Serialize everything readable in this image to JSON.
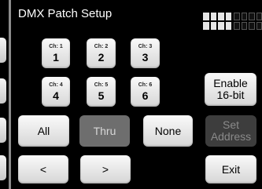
{
  "title": "DMX Patch Setup",
  "icons": {
    "grid_selected": "grid-icon",
    "grid_unselected": "grid-icon"
  },
  "channels": [
    {
      "label": "Ch: 1",
      "number": "1"
    },
    {
      "label": "Ch: 2",
      "number": "2"
    },
    {
      "label": "Ch: 3",
      "number": "3"
    },
    {
      "label": "Ch: 4",
      "number": "4"
    },
    {
      "label": "Ch: 5",
      "number": "5"
    },
    {
      "label": "Ch: 6",
      "number": "6"
    }
  ],
  "buttons": {
    "enable_16bit_line1": "Enable",
    "enable_16bit_line2": "16-bit",
    "all": "All",
    "thru": "Thru",
    "none": "None",
    "set_address_line1": "Set",
    "set_address_line2": "Address",
    "prev": "<",
    "next": ">",
    "exit": "Exit"
  },
  "colors": {
    "background": "#000000",
    "button": "#e8e8e8",
    "disabled_button": "#6e6e6e"
  }
}
